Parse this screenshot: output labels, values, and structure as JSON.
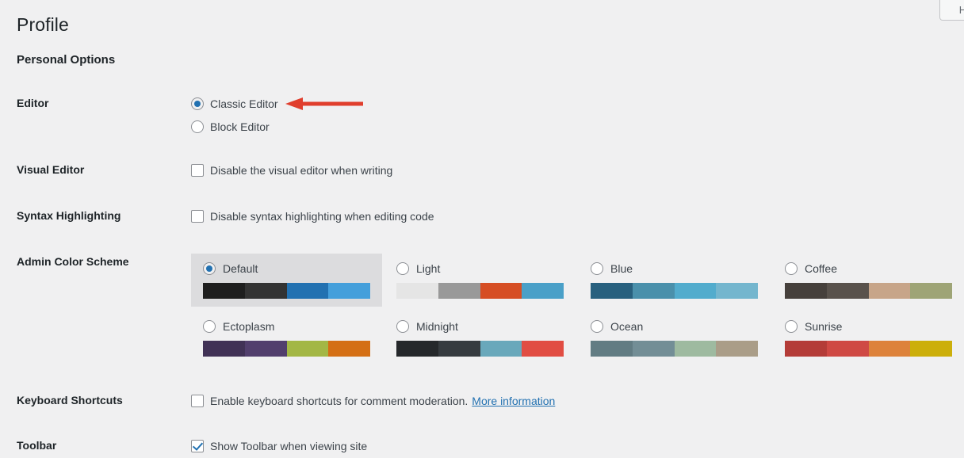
{
  "help_tab": {
    "label": "He"
  },
  "page_title": "Profile",
  "section_heading": "Personal Options",
  "rows": {
    "editor": {
      "label": "Editor",
      "options": [
        {
          "label": "Classic Editor",
          "checked": true
        },
        {
          "label": "Block Editor",
          "checked": false
        }
      ]
    },
    "visual_editor": {
      "label": "Visual Editor",
      "checkbox_label": "Disable the visual editor when writing",
      "checked": false
    },
    "syntax_highlighting": {
      "label": "Syntax Highlighting",
      "checkbox_label": "Disable syntax highlighting when editing code",
      "checked": false
    },
    "admin_color_scheme": {
      "label": "Admin Color Scheme",
      "schemes": [
        {
          "name": "Default",
          "selected": true,
          "colors": [
            "#1e1e1e",
            "#333333",
            "#2271b1",
            "#449fdb"
          ]
        },
        {
          "name": "Light",
          "selected": false,
          "colors": [
            "#e5e5e5",
            "#999999",
            "#d64e24",
            "#4aa0c8"
          ]
        },
        {
          "name": "Blue",
          "selected": false,
          "colors": [
            "#28607e",
            "#4a90ab",
            "#52accd",
            "#74b6ce"
          ]
        },
        {
          "name": "Coffee",
          "selected": false,
          "colors": [
            "#46403c",
            "#59524c",
            "#c7a589",
            "#9ea476"
          ]
        },
        {
          "name": "Ectoplasm",
          "selected": false,
          "colors": [
            "#413256",
            "#523f6d",
            "#a3b745",
            "#d46f15"
          ]
        },
        {
          "name": "Midnight",
          "selected": false,
          "colors": [
            "#25282b",
            "#363b3f",
            "#69a8bb",
            "#e14d43"
          ]
        },
        {
          "name": "Ocean",
          "selected": false,
          "colors": [
            "#627c83",
            "#738e96",
            "#9ebaa0",
            "#aa9d88"
          ]
        },
        {
          "name": "Sunrise",
          "selected": false,
          "colors": [
            "#b43c38",
            "#cf4944",
            "#dd823b",
            "#ccaf0b"
          ]
        }
      ]
    },
    "keyboard_shortcuts": {
      "label": "Keyboard Shortcuts",
      "checkbox_label": "Enable keyboard shortcuts for comment moderation.",
      "link_label": "More information",
      "checked": false
    },
    "toolbar": {
      "label": "Toolbar",
      "checkbox_label": "Show Toolbar when viewing site",
      "checked": true
    }
  },
  "annotation": {
    "type": "arrow-left",
    "color": "#e03e2d"
  }
}
